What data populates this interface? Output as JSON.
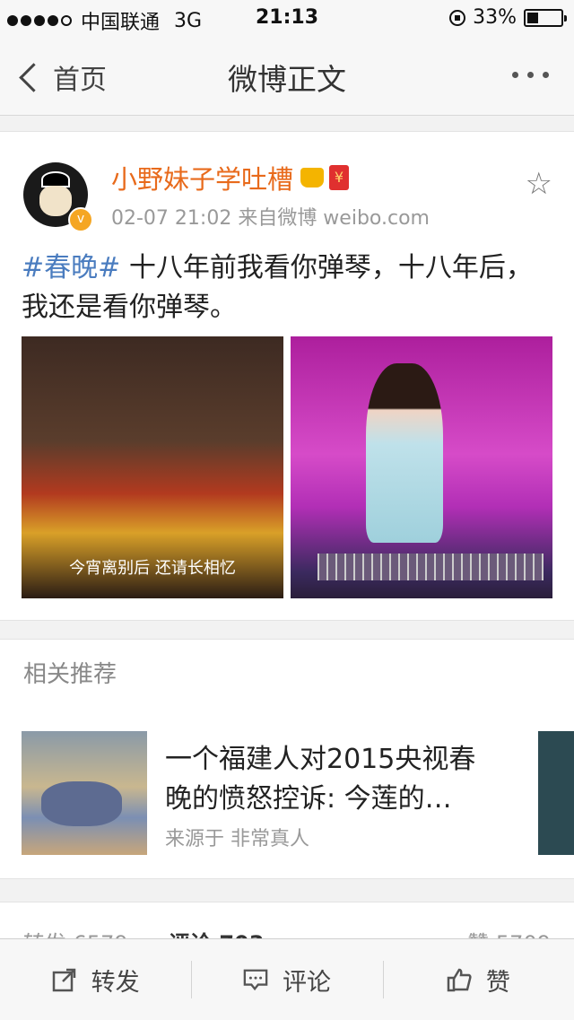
{
  "status": {
    "carrier": "中国联通",
    "network": "3G",
    "time": "21:13",
    "battery_text": "33%",
    "battery_level": 0.33
  },
  "nav": {
    "back_label": "首页",
    "title": "微博正文"
  },
  "post": {
    "username": "小野妹子学吐槽",
    "meta": "02-07 21:02  来自微博 weibo.com",
    "hashtag": "#春晚#",
    "text": " 十八年前我看你弹琴，十八年后，我还是看你弹琴。",
    "image1_subtitle": "今宵离别后  还请长相忆"
  },
  "related": {
    "header": "相关推荐",
    "title": "一个福建人对2015央视春晚的愤怒控诉: 今莲的…",
    "source": "来源于 非常真人"
  },
  "stats": {
    "repost": "转发 6579",
    "comment": "评论 703",
    "like": "赞 5709"
  },
  "toolbar": {
    "repost": "转发",
    "comment": "评论",
    "like": "赞"
  },
  "colors": {
    "username": "#e86a1b",
    "hashtag": "#4a7cbf",
    "verified_badge": "#f5a623"
  }
}
